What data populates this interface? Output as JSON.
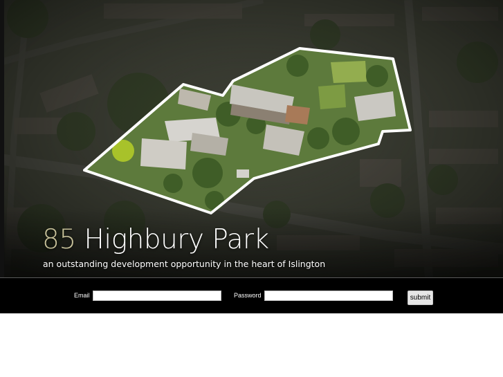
{
  "hero": {
    "title_number": "85",
    "title_name": "Highbury Park",
    "tagline": "an outstanding development opportunity in the heart of Islington"
  },
  "login": {
    "email_label": "Email",
    "email_value": "",
    "password_label": "Password",
    "password_value": "",
    "submit_label": "submit"
  },
  "colors": {
    "login_bar": "#000000",
    "title_number": "#c8c29a",
    "title_text": "#ffffff",
    "site_outline": "#ffffff"
  }
}
